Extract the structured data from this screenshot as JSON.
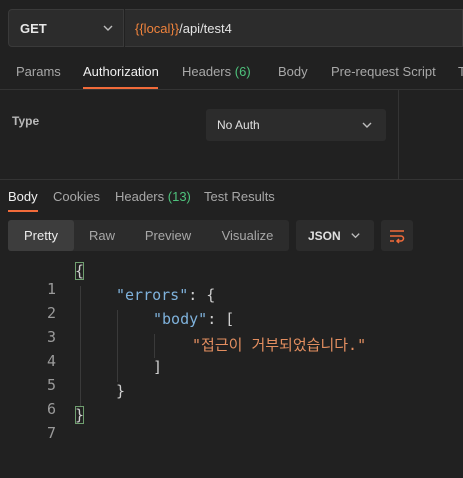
{
  "request": {
    "method": "GET",
    "url_variable": "{{local}}",
    "url_path": "/api/test4"
  },
  "request_tabs": [
    {
      "label": "Params",
      "count": ""
    },
    {
      "label": "Authorization",
      "count": ""
    },
    {
      "label": "Headers",
      "count": "(6)"
    },
    {
      "label": "Body",
      "count": ""
    },
    {
      "label": "Pre-request Script",
      "count": ""
    },
    {
      "label": "T",
      "count": ""
    }
  ],
  "auth": {
    "type_label": "Type",
    "selected": "No Auth"
  },
  "response_tabs": [
    {
      "label": "Body",
      "count": ""
    },
    {
      "label": "Cookies",
      "count": ""
    },
    {
      "label": "Headers",
      "count": "(13)"
    },
    {
      "label": "Test Results",
      "count": ""
    }
  ],
  "view_options": [
    "Pretty",
    "Raw",
    "Preview",
    "Visualize"
  ],
  "format": "JSON",
  "icons": {
    "method_dropdown": "chevron-down-icon",
    "auth_dropdown": "chevron-down-icon",
    "format_dropdown": "chevron-down-icon",
    "wrap": "wrap-lines-icon"
  },
  "colors": {
    "accent": "#f26b3a",
    "variable": "#f0833c",
    "count": "#4ec27c",
    "json_key": "#7fb2dc",
    "json_string": "#e38e60"
  },
  "code": {
    "line_numbers": [
      "1",
      "2",
      "3",
      "4",
      "5",
      "6",
      "7"
    ],
    "l1": "{",
    "l2_key": "\"errors\"",
    "l2_rest": ": {",
    "l3_key": "\"body\"",
    "l3_rest": ": [",
    "l4": "\"접근이 거부되었습니다.\"",
    "l5": "]",
    "l6": "}",
    "l7": "}"
  }
}
